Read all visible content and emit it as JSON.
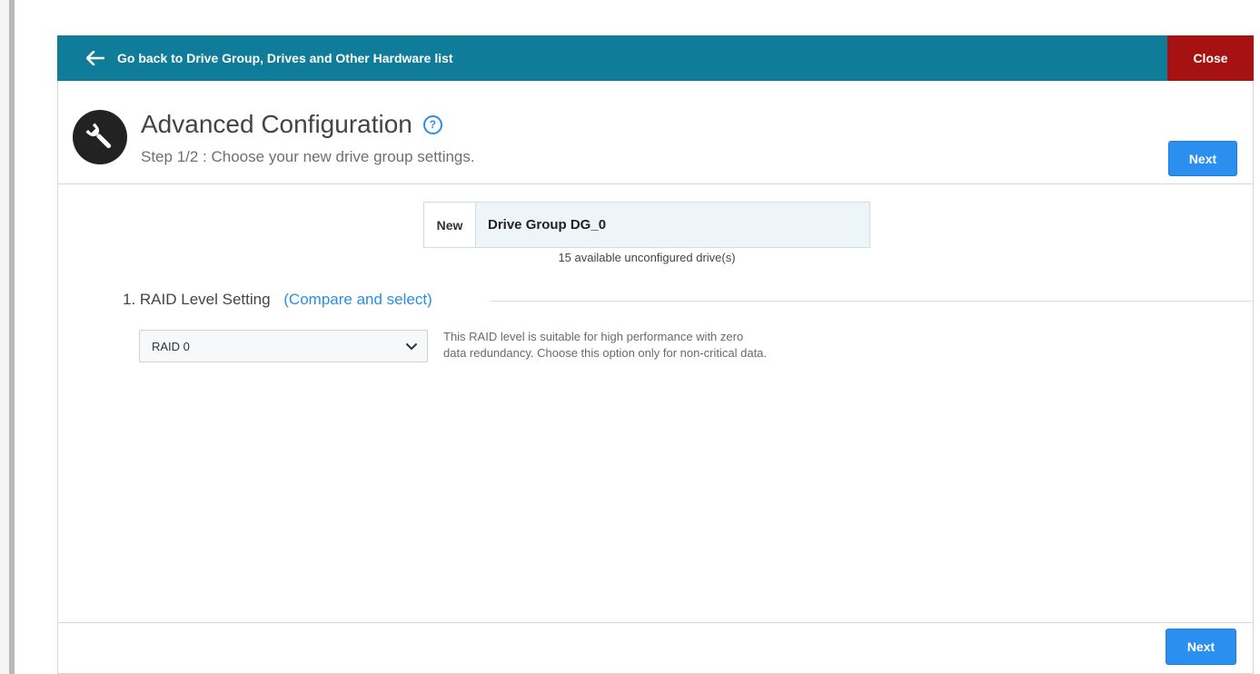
{
  "topbar": {
    "back_label": "Go back to Drive Group, Drives and Other Hardware list",
    "close_label": "Close",
    "color": "#0f7c99",
    "close_color": "#a61111"
  },
  "header": {
    "icon": "wrench-icon",
    "title": "Advanced Configuration",
    "help_icon": "help-icon",
    "help_glyph": "?",
    "subtitle": "Step 1/2 : Choose your new drive group settings.",
    "next_label": "Next"
  },
  "drive_group": {
    "prefix": "New",
    "name": "Drive Group DG_0",
    "available_text": "15 available unconfigured drive(s)"
  },
  "raid_section": {
    "title": "1. RAID Level Setting",
    "compare_link": "(Compare and select)",
    "selected": "RAID 0",
    "description_line1": "This RAID level is suitable for high performance with zero",
    "description_line2": "data redundancy. Choose this option only for non-critical data."
  },
  "footer": {
    "next_label": "Next",
    "accent": "#2b8ff0"
  }
}
